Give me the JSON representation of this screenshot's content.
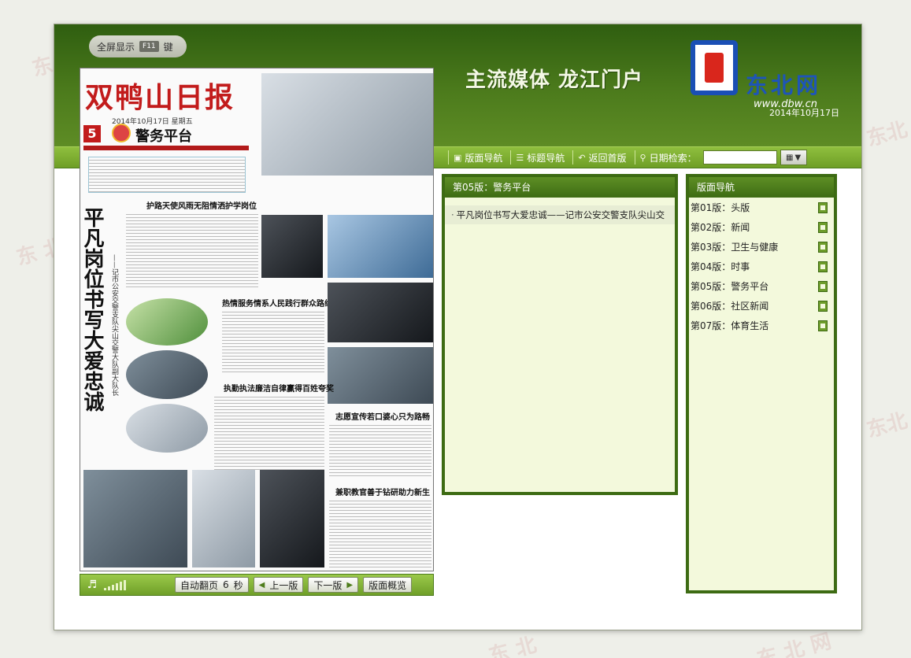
{
  "header": {
    "fullscreen_label": "全屏显示",
    "fullscreen_key": "F11",
    "fullscreen_suffix": "键",
    "slogan": "主流媒体  龙江门户",
    "logo_name": "东北网",
    "logo_url": "www.dbw.cn",
    "date": "2014年10月17日"
  },
  "toolbar": {
    "layout_nav": "版面导航",
    "title_nav": "标题导航",
    "home": "返回首版",
    "date_search": "日期检索："
  },
  "newspaper": {
    "masthead": "双鸭山日报",
    "dateline": "2014年10月17日  星期五",
    "page_number": "5",
    "section": "警务平台",
    "main_title": "平凡岗位书写大爱忠诚",
    "subtitle": "——记市公安交警支队尖山交警大队副大队长",
    "headlines": [
      "护路天使风雨无阻情洒护学岗位",
      "热情服务情系人民践行群众路线",
      "执勤执法廉洁自律赢得百姓夸奖",
      "志愿宣传若口婆心只为路畅民安",
      "兼职教官善于钻研助力新生力量"
    ]
  },
  "paper_controls": {
    "autoflip_label": "自动翻页",
    "autoflip_value": "6",
    "autoflip_unit": "秒",
    "prev": "上一版",
    "next": "下一版",
    "overview": "版面概览"
  },
  "articles_panel": {
    "title": "第05版：警务平台",
    "items": [
      "平凡岗位书写大爱忠诚——记市公安交警支队尖山交"
    ]
  },
  "layouts_panel": {
    "title": "版面导航",
    "items": [
      "第01版：头版",
      "第02版：新闻",
      "第03版：卫生与健康",
      "第04版：时事",
      "第05版：警务平台",
      "第06版：社区新闻",
      "第07版：体育生活"
    ]
  },
  "icons": {
    "layout_nav": "page-icon",
    "title_nav": "list-icon",
    "home": "return-icon",
    "date_search": "search-icon",
    "calendar": "calendar-icon",
    "pdf": "pdf-icon",
    "speaker": "speaker-icon"
  },
  "colors": {
    "header_green": "#3d6b13",
    "panel_bg": "#f3f9dc",
    "masthead_red": "#c21b1b"
  }
}
